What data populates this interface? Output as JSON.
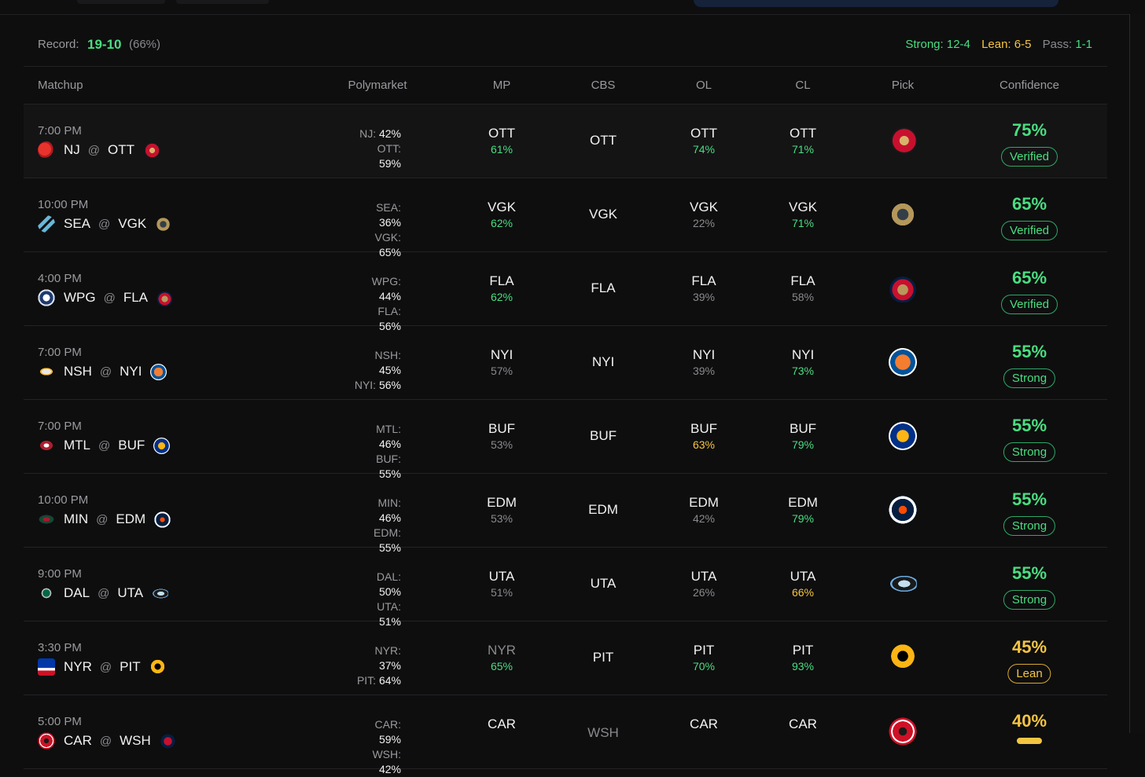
{
  "record": {
    "label": "Record:",
    "value": "19-10",
    "pct": "(66%)"
  },
  "summary": {
    "strong": "Strong: 12-4",
    "lean": "Lean: 6-5",
    "pass_label": "Pass:",
    "pass_value": "1-1"
  },
  "columns": {
    "matchup": "Matchup",
    "polymarket": "Polymarket",
    "mp": "MP",
    "cbs": "CBS",
    "ol": "OL",
    "cl": "CL",
    "pick": "Pick",
    "confidence": "Confidence"
  },
  "colors": {
    "green": "#4ade80",
    "yellow": "#f5c542",
    "gray": "#8a8a8e",
    "background": "#0e0e0f"
  },
  "games": [
    {
      "time": "7:00 PM",
      "away": "NJ",
      "home": "OTT",
      "away_icon": "devils-logo-icon",
      "home_icon": "senators-logo-icon",
      "poly_away": "NJ:",
      "poly_away_val": "42%",
      "poly_home": "OTT:",
      "poly_home_val": "59%",
      "mp": "OTT",
      "mp_pct": "61%",
      "mp_pct_color": "green",
      "mp_dim": false,
      "cbs": "OTT",
      "cbs_dim": false,
      "ol": "OTT",
      "ol_pct": "74%",
      "ol_pct_color": "green",
      "cl": "OTT",
      "cl_pct": "71%",
      "cl_pct_color": "green",
      "pick_icon": "senators-logo-icon",
      "confidence": "75%",
      "conf_color": "green",
      "badge": "Verified",
      "badge_type": "verified"
    },
    {
      "time": "10:00 PM",
      "away": "SEA",
      "home": "VGK",
      "away_icon": "kraken-logo-icon",
      "home_icon": "golden-knights-logo-icon",
      "poly_away": "SEA:",
      "poly_away_val": "36%",
      "poly_home": "VGK:",
      "poly_home_val": "65%",
      "mp": "VGK",
      "mp_pct": "62%",
      "mp_pct_color": "green",
      "mp_dim": false,
      "cbs": "VGK",
      "cbs_dim": false,
      "ol": "VGK",
      "ol_pct": "22%",
      "ol_pct_color": "gray",
      "cl": "VGK",
      "cl_pct": "71%",
      "cl_pct_color": "green",
      "pick_icon": "golden-knights-logo-icon",
      "confidence": "65%",
      "conf_color": "green",
      "badge": "Verified",
      "badge_type": "verified"
    },
    {
      "time": "4:00 PM",
      "away": "WPG",
      "home": "FLA",
      "away_icon": "jets-logo-icon",
      "home_icon": "panthers-logo-icon",
      "poly_away": "WPG:",
      "poly_away_val": "44%",
      "poly_home": "FLA:",
      "poly_home_val": "56%",
      "mp": "FLA",
      "mp_pct": "62%",
      "mp_pct_color": "green",
      "mp_dim": false,
      "cbs": "FLA",
      "cbs_dim": false,
      "ol": "FLA",
      "ol_pct": "39%",
      "ol_pct_color": "gray",
      "cl": "FLA",
      "cl_pct": "58%",
      "cl_pct_color": "gray",
      "pick_icon": "panthers-logo-icon",
      "confidence": "65%",
      "conf_color": "green",
      "badge": "Verified",
      "badge_type": "verified"
    },
    {
      "time": "7:00 PM",
      "away": "NSH",
      "home": "NYI",
      "away_icon": "predators-logo-icon",
      "home_icon": "islanders-logo-icon",
      "poly_away": "NSH:",
      "poly_away_val": "45%",
      "poly_home": "NYI:",
      "poly_home_val": "56%",
      "mp": "NYI",
      "mp_pct": "57%",
      "mp_pct_color": "gray",
      "mp_dim": false,
      "cbs": "NYI",
      "cbs_dim": false,
      "ol": "NYI",
      "ol_pct": "39%",
      "ol_pct_color": "gray",
      "cl": "NYI",
      "cl_pct": "73%",
      "cl_pct_color": "green",
      "pick_icon": "islanders-logo-icon",
      "confidence": "55%",
      "conf_color": "green",
      "badge": "Strong",
      "badge_type": "strong"
    },
    {
      "time": "7:00 PM",
      "away": "MTL",
      "home": "BUF",
      "away_icon": "canadiens-logo-icon",
      "home_icon": "sabres-logo-icon",
      "poly_away": "MTL:",
      "poly_away_val": "46%",
      "poly_home": "BUF:",
      "poly_home_val": "55%",
      "mp": "BUF",
      "mp_pct": "53%",
      "mp_pct_color": "gray",
      "mp_dim": false,
      "cbs": "BUF",
      "cbs_dim": false,
      "ol": "BUF",
      "ol_pct": "63%",
      "ol_pct_color": "yellow",
      "cl": "BUF",
      "cl_pct": "79%",
      "cl_pct_color": "green",
      "pick_icon": "sabres-logo-icon",
      "confidence": "55%",
      "conf_color": "green",
      "badge": "Strong",
      "badge_type": "strong"
    },
    {
      "time": "10:00 PM",
      "away": "MIN",
      "home": "EDM",
      "away_icon": "wild-logo-icon",
      "home_icon": "oilers-logo-icon",
      "poly_away": "MIN:",
      "poly_away_val": "46%",
      "poly_home": "EDM:",
      "poly_home_val": "55%",
      "mp": "EDM",
      "mp_pct": "53%",
      "mp_pct_color": "gray",
      "mp_dim": false,
      "cbs": "EDM",
      "cbs_dim": false,
      "ol": "EDM",
      "ol_pct": "42%",
      "ol_pct_color": "gray",
      "cl": "EDM",
      "cl_pct": "79%",
      "cl_pct_color": "green",
      "pick_icon": "oilers-logo-icon",
      "confidence": "55%",
      "conf_color": "green",
      "badge": "Strong",
      "badge_type": "strong"
    },
    {
      "time": "9:00 PM",
      "away": "DAL",
      "home": "UTA",
      "away_icon": "stars-logo-icon",
      "home_icon": "utah-logo-icon",
      "poly_away": "DAL:",
      "poly_away_val": "50%",
      "poly_home": "UTA:",
      "poly_home_val": "51%",
      "mp": "UTA",
      "mp_pct": "51%",
      "mp_pct_color": "gray",
      "mp_dim": false,
      "cbs": "UTA",
      "cbs_dim": false,
      "ol": "UTA",
      "ol_pct": "26%",
      "ol_pct_color": "gray",
      "cl": "UTA",
      "cl_pct": "66%",
      "cl_pct_color": "yellow",
      "pick_icon": "utah-logo-icon",
      "confidence": "55%",
      "conf_color": "green",
      "badge": "Strong",
      "badge_type": "strong"
    },
    {
      "time": "3:30 PM",
      "away": "NYR",
      "home": "PIT",
      "away_icon": "rangers-logo-icon",
      "home_icon": "penguins-logo-icon",
      "poly_away": "NYR:",
      "poly_away_val": "37%",
      "poly_home": "PIT:",
      "poly_home_val": "64%",
      "mp": "NYR",
      "mp_pct": "65%",
      "mp_pct_color": "green",
      "mp_dim": true,
      "cbs": "PIT",
      "cbs_dim": false,
      "ol": "PIT",
      "ol_pct": "70%",
      "ol_pct_color": "green",
      "cl": "PIT",
      "cl_pct": "93%",
      "cl_pct_color": "green",
      "pick_icon": "penguins-logo-icon",
      "confidence": "45%",
      "conf_color": "yellow",
      "badge": "Lean",
      "badge_type": "lean"
    },
    {
      "time": "5:00 PM",
      "away": "CAR",
      "home": "WSH",
      "away_icon": "hurricanes-logo-icon",
      "home_icon": "capitals-logo-icon",
      "poly_away": "CAR:",
      "poly_away_val": "59%",
      "poly_home": "WSH:",
      "poly_home_val": "42%",
      "mp": "CAR",
      "mp_pct": "",
      "mp_pct_color": "gray",
      "mp_dim": false,
      "cbs": "WSH",
      "cbs_dim": true,
      "ol": "CAR",
      "ol_pct": "",
      "ol_pct_color": "gray",
      "cl": "CAR",
      "cl_pct": "",
      "cl_pct_color": "gray",
      "pick_icon": "hurricanes-logo-icon",
      "confidence": "40%",
      "conf_color": "yellow",
      "badge": "",
      "badge_type": "lean"
    }
  ]
}
